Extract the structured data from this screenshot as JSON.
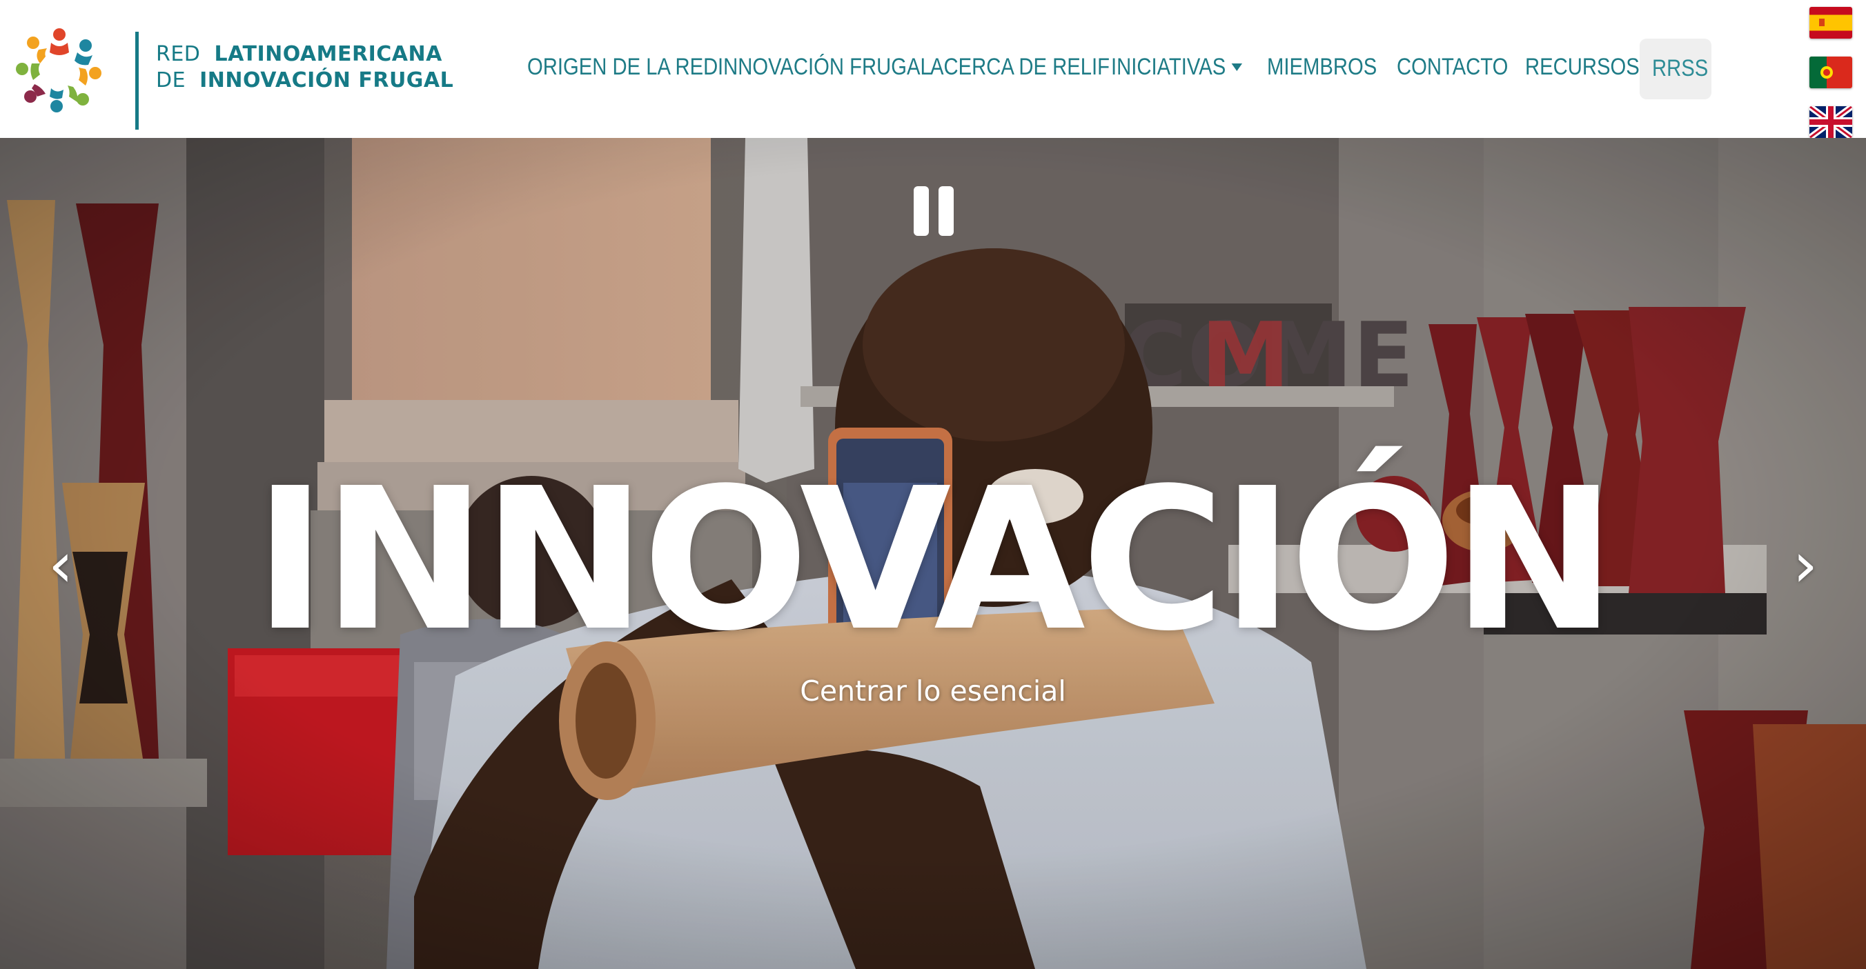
{
  "logo": {
    "line1_light": "RED",
    "line1_bold": "LATINOAMERICANA",
    "line2_light": "DE",
    "line2_bold": "INNOVACIÓN FRUGAL",
    "brand_color": "#167a86"
  },
  "nav": {
    "items": [
      {
        "label": "ORIGEN DE LA RED"
      },
      {
        "label": "INNOVACIÓN FRUGAL"
      },
      {
        "label": "ACERCA DE RELIF"
      },
      {
        "label": "INICIATIVAS",
        "icon": "caret-down-icon"
      },
      {
        "label": "MIEMBROS"
      },
      {
        "label": "CONTACTO"
      },
      {
        "label": "RECURSOS"
      }
    ],
    "rrss": "RRSS",
    "color": "#1e7b86"
  },
  "languages": [
    {
      "icon": "flag-spain-icon"
    },
    {
      "icon": "flag-portugal-icon"
    },
    {
      "icon": "flag-uk-icon"
    }
  ],
  "hero": {
    "title": "INNOVACIÓN",
    "subtitle": "Centrar lo esencial",
    "prev_icon": "‹",
    "next_icon": "›",
    "pause_icon": "pause-icon",
    "background_text": "COME"
  }
}
